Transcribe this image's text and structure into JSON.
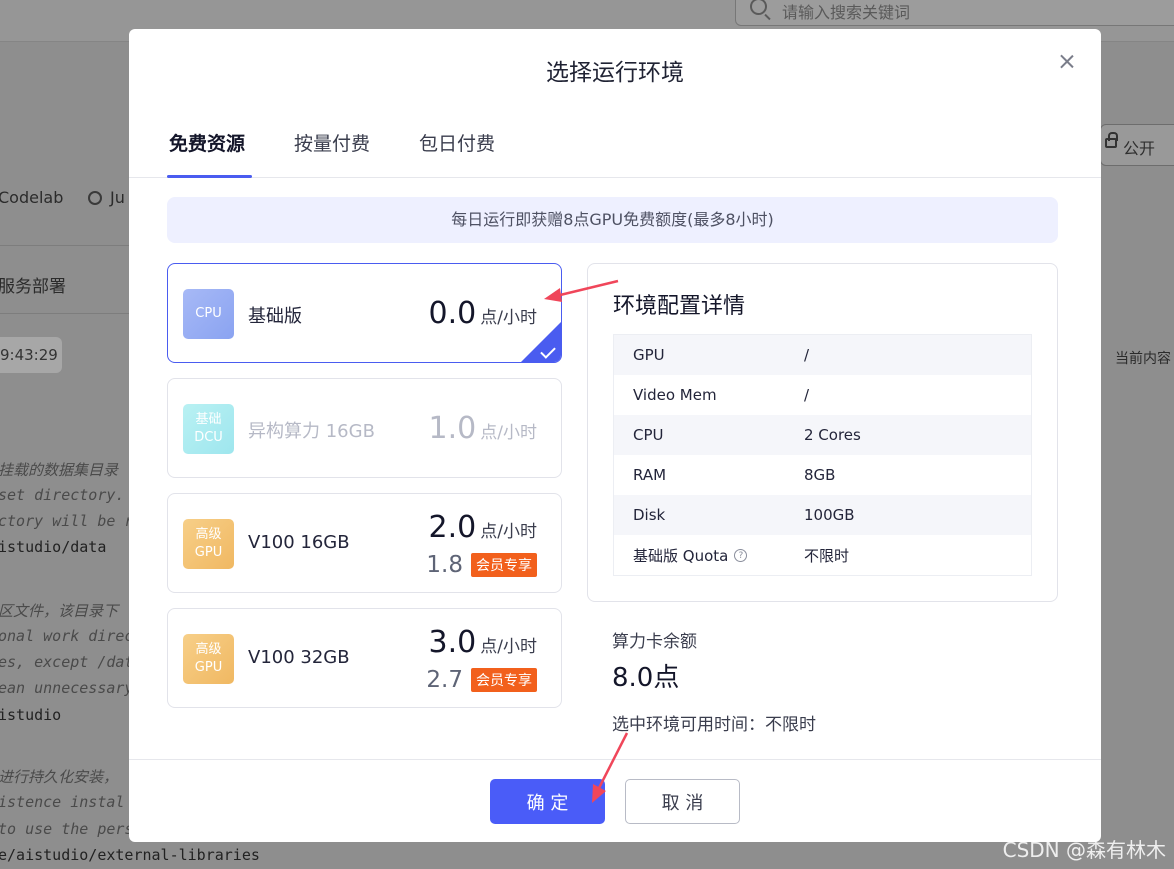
{
  "background": {
    "search_placeholder": "请输入搜索关键词",
    "publish_label": "公开",
    "nav_items": [
      "Codelab",
      "Ju"
    ],
    "section_label": "服务部署",
    "time_chip": "9:43:29",
    "current_content": "当前内容",
    "code_lines": [
      {
        "text": "挂载的数据集目录",
        "style": "it"
      },
      {
        "text": "set directory.",
        "style": "it"
      },
      {
        "text": "ctory will be r",
        "style": "it"
      },
      {
        "text": "istudio/data",
        "style": "mono"
      },
      {
        "text": "区文件，该目录下",
        "style": "it"
      },
      {
        "text": "onal work direc",
        "style": "it"
      },
      {
        "text": "es, except /dat",
        "style": "it"
      },
      {
        "text": "ean unnecessary",
        "style": "it"
      },
      {
        "text": "istudio",
        "style": "mono"
      },
      {
        "text": "进行持久化安装，",
        "style": "it"
      },
      {
        "text": "istence instal",
        "style": "it"
      },
      {
        "text": "to use the pers",
        "style": "it"
      },
      {
        "text": "e/aistudio/external-libraries",
        "style": "mono"
      }
    ]
  },
  "modal": {
    "title": "选择运行环境",
    "tabs": [
      {
        "label": "免费资源",
        "active": true
      },
      {
        "label": "按量付费",
        "active": false
      },
      {
        "label": "包日付费",
        "active": false
      }
    ],
    "notice": "每日运行即获赠8点GPU免费额度(最多8小时)",
    "plans": [
      {
        "badge_lines": [
          "CPU"
        ],
        "badge_color": "blue",
        "name": "基础版",
        "price": "0.0",
        "unit": "点/小时",
        "selected": true,
        "disabled": false
      },
      {
        "badge_lines": [
          "基础",
          "DCU"
        ],
        "badge_color": "cyan",
        "name": "异构算力 16GB",
        "price": "1.0",
        "unit": "点/小时",
        "selected": false,
        "disabled": true
      },
      {
        "badge_lines": [
          "高级",
          "GPU"
        ],
        "badge_color": "gold",
        "name": "V100 16GB",
        "price": "2.0",
        "unit": "点/小时",
        "member_price": "1.8",
        "member_tag": "会员专享",
        "selected": false,
        "disabled": false
      },
      {
        "badge_lines": [
          "高级",
          "GPU"
        ],
        "badge_color": "gold",
        "name": "V100 32GB",
        "price": "3.0",
        "unit": "点/小时",
        "member_price": "2.7",
        "member_tag": "会员专享",
        "selected": false,
        "disabled": false
      }
    ],
    "details": {
      "title": "环境配置详情",
      "rows": [
        {
          "key": "GPU",
          "value": "/"
        },
        {
          "key": "Video Mem",
          "value": "/"
        },
        {
          "key": "CPU",
          "value": "2 Cores"
        },
        {
          "key": "RAM",
          "value": "8GB"
        },
        {
          "key": "Disk",
          "value": "100GB"
        },
        {
          "key": "基础版 Quota",
          "value": "不限时",
          "help": true
        }
      ]
    },
    "balance_label": "算力卡余额",
    "balance_value": "8.0点",
    "available_time": "选中环境可用时间：不限时",
    "confirm_label": "确 定",
    "cancel_label": "取 消"
  },
  "watermark": "CSDN @森有林木",
  "colors": {
    "accent": "#4a5cf0",
    "primary_button": "#4a5cf8",
    "vip_tag": "#f2601c",
    "arrow": "#f0465a"
  }
}
